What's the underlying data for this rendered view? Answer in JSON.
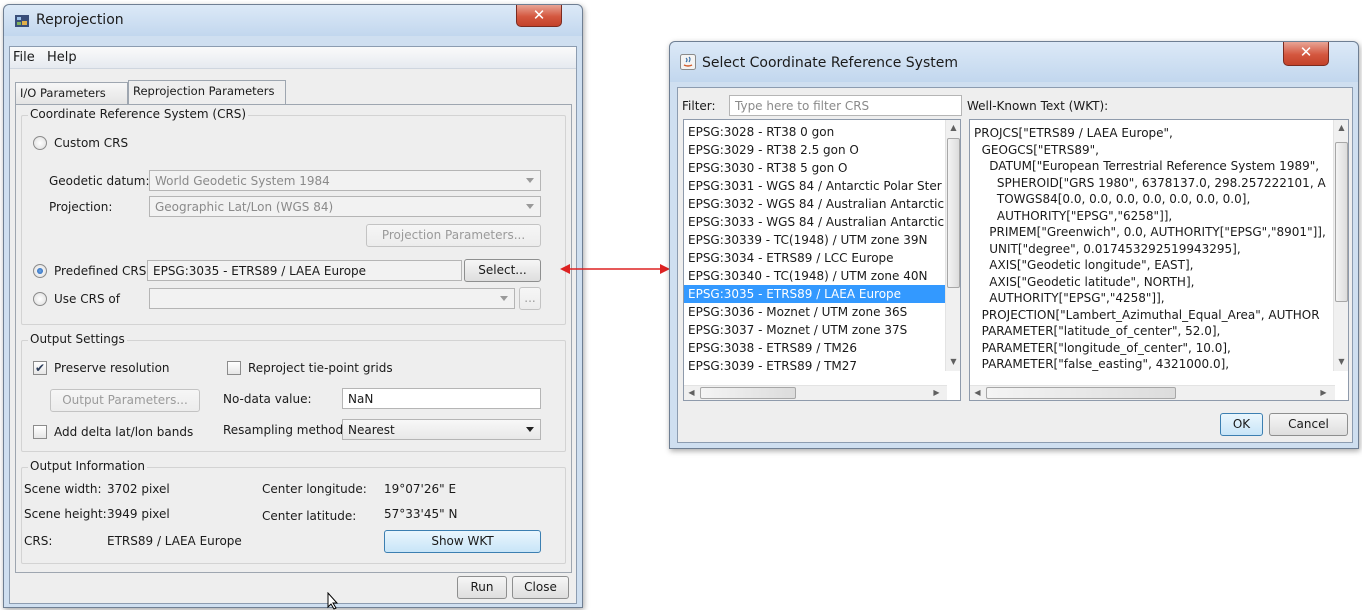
{
  "reprojection": {
    "title": "Reprojection",
    "menu": [
      "File",
      "Help"
    ],
    "tabs": [
      "I/O Parameters",
      "Reprojection Parameters"
    ],
    "crs_group": {
      "title": "Coordinate Reference System (CRS)",
      "custom_crs": "Custom CRS",
      "geodetic_datum_label": "Geodetic datum:",
      "geodetic_datum_value": "World Geodetic System 1984",
      "projection_label": "Projection:",
      "projection_value": "Geographic Lat/Lon (WGS 84)",
      "projection_params_button": "Projection Parameters...",
      "predefined_crs": "Predefined CRS",
      "predefined_value": "EPSG:3035 - ETRS89 / LAEA Europe",
      "select_button": "Select...",
      "use_crs_of": "Use CRS of",
      "use_crs_value": "",
      "more_button": "..."
    },
    "output_settings": {
      "title": "Output Settings",
      "preserve_resolution": "Preserve resolution",
      "preserve_resolution_checked": true,
      "reproject_tiepoint": "Reproject tie-point grids",
      "reproject_tiepoint_checked": false,
      "output_params_button": "Output Parameters...",
      "nodata_label": "No-data value:",
      "nodata_value": "NaN",
      "add_delta": "Add delta lat/lon bands",
      "add_delta_checked": false,
      "resampling_label": "Resampling method:",
      "resampling_value": "Nearest"
    },
    "output_info": {
      "title": "Output Information",
      "scene_width_label": "Scene width:",
      "scene_width_value": "3702 pixel",
      "scene_height_label": "Scene height:",
      "scene_height_value": "3949 pixel",
      "center_lon_label": "Center longitude:",
      "center_lon_value": "19°07'26\" E",
      "center_lat_label": "Center latitude:",
      "center_lat_value": "57°33'45\" N",
      "crs_label": "CRS:",
      "crs_value": "ETRS89 / LAEA Europe",
      "show_wkt_button": "Show WKT"
    },
    "run_button": "Run",
    "close_button": "Close"
  },
  "select_crs": {
    "title": "Select Coordinate Reference System",
    "filter_label": "Filter:",
    "filter_placeholder": "Type here to filter CRS",
    "wkt_label": "Well-Known Text (WKT):",
    "crs_list": [
      "EPSG:3028 - RT38 0 gon",
      "EPSG:3029 - RT38 2.5 gon O",
      "EPSG:3030 - RT38 5 gon O",
      "EPSG:3031 - WGS 84 / Antarctic Polar Ster",
      "EPSG:3032 - WGS 84 / Australian Antarctic",
      "EPSG:3033 - WGS 84 / Australian Antarctic",
      "EPSG:30339 - TC(1948) / UTM zone 39N",
      "EPSG:3034 - ETRS89 / LCC Europe",
      "EPSG:30340 - TC(1948) / UTM zone 40N",
      "EPSG:3035 - ETRS89 / LAEA Europe",
      "EPSG:3036 - Moznet / UTM zone 36S",
      "EPSG:3037 - Moznet / UTM zone 37S",
      "EPSG:3038 - ETRS89 / TM26",
      "EPSG:3039 - ETRS89 / TM27"
    ],
    "selected_index": 9,
    "wkt_lines": [
      "PROJCS[\"ETRS89 / LAEA Europe\",",
      "  GEOGCS[\"ETRS89\",",
      "    DATUM[\"European Terrestrial Reference System 1989\",",
      "      SPHEROID[\"GRS 1980\", 6378137.0, 298.257222101, A",
      "      TOWGS84[0.0, 0.0, 0.0, 0.0, 0.0, 0.0, 0.0],",
      "      AUTHORITY[\"EPSG\",\"6258\"]],",
      "    PRIMEM[\"Greenwich\", 0.0, AUTHORITY[\"EPSG\",\"8901\"]],",
      "    UNIT[\"degree\", 0.017453292519943295],",
      "    AXIS[\"Geodetic longitude\", EAST],",
      "    AXIS[\"Geodetic latitude\", NORTH],",
      "    AUTHORITY[\"EPSG\",\"4258\"]],",
      "  PROJECTION[\"Lambert_Azimuthal_Equal_Area\", AUTHOR",
      "  PARAMETER[\"latitude_of_center\", 52.0],",
      "  PARAMETER[\"longitude_of_center\", 10.0],",
      "  PARAMETER[\"false_easting\", 4321000.0],"
    ],
    "ok_button": "OK",
    "cancel_button": "Cancel"
  },
  "colors": {
    "arrow": "#dd2222",
    "selection": "#3399ff",
    "close_red": "#d4573f"
  }
}
